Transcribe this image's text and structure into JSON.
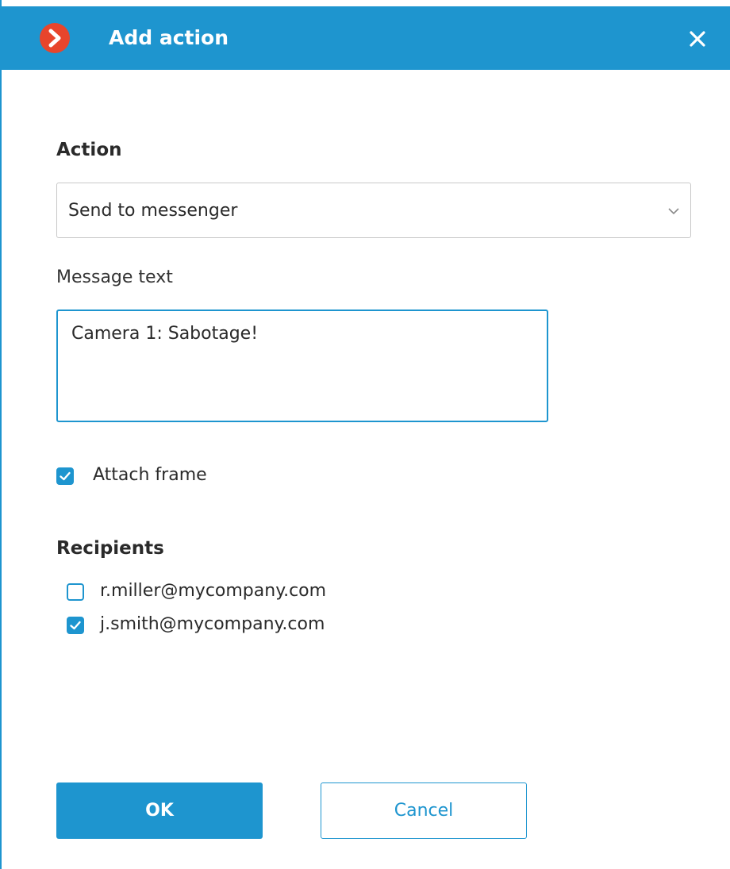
{
  "window": {
    "title": "Add action",
    "logo_icon": "app-logo-chevron-icon",
    "close_icon": "close-icon"
  },
  "action": {
    "label": "Action",
    "selected": "Send to messenger"
  },
  "message": {
    "label": "Message text",
    "value": "Camera 1: Sabotage!"
  },
  "attach_frame": {
    "label": "Attach frame",
    "checked": true
  },
  "recipients": {
    "label": "Recipients",
    "items": [
      {
        "label": "r.miller@mycompany.com",
        "checked": false
      },
      {
        "label": "j.smith@mycompany.com",
        "checked": true
      }
    ]
  },
  "buttons": {
    "ok_label": "OK",
    "cancel_label": "Cancel"
  },
  "colors": {
    "accent": "#1e95cf",
    "logo": "#e8452c",
    "text": "#2a2a2a"
  }
}
